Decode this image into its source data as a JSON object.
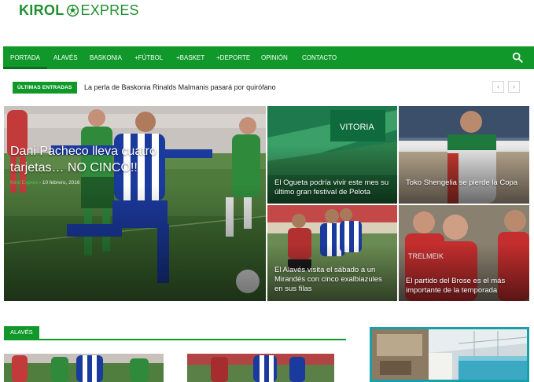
{
  "brand": {
    "part1": "KIROL",
    "part2": "EXPRES"
  },
  "nav": {
    "items": [
      "PORTADA",
      "ALAVÉS",
      "BASKONIA",
      "+FÚTBOL",
      "+BASKET",
      "+DEPORTE",
      "OPINIÓN",
      "CONTACTO"
    ],
    "active_index": 0
  },
  "ticker": {
    "label": "ÚLTIMAS ENTRADAS",
    "headline": "La perla de Baskonia Rinalds Malmanis pasará por quirófano",
    "prev_icon": "chevron-left-icon",
    "next_icon": "chevron-right-icon"
  },
  "featured": {
    "main": {
      "title": "Dani Pacheco lleva cuatro tarjetas… NO CINCO!!",
      "author": "Kirol Expres",
      "date": "10 febrero, 2016"
    },
    "top_middle": {
      "title": "El Ogueta podría vivir este mes su último gran festival de Pelota"
    },
    "top_right": {
      "title": "Toko Shengelia se pierde la Copa"
    },
    "bottom_middle": {
      "title": "El Alavés visita el sábado a un Mirandés con cinco exalbiazules en sus filas"
    },
    "bottom_right": {
      "title": "El partido del Brose es el más importante de la temporada"
    }
  },
  "section": {
    "label": "ALAVÉS"
  },
  "colors": {
    "brand_green": "#10992a",
    "dark_green": "#0b6e1d",
    "ad_border": "#1aa0a8"
  }
}
